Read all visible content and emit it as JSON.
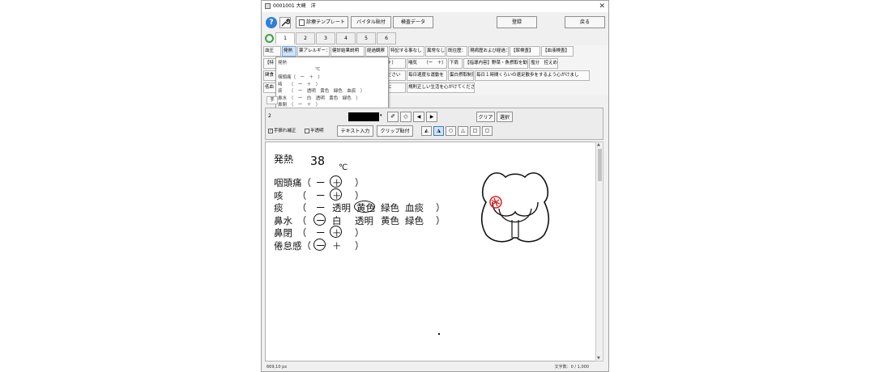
{
  "window": {
    "title": "0001001 大崎　洋",
    "close_glyph": "✕"
  },
  "toolbar": {
    "help": "?",
    "wrench": "🔧",
    "template_button": "診療テンプレート",
    "vital_button": "バイタル貼付",
    "exam_button": "検査データ",
    "register_button": "登録",
    "back_button": "戻る"
  },
  "number_tabs": [
    "1",
    "2",
    "3",
    "4",
    "5",
    "6"
  ],
  "active_number_tab": "1",
  "phrase_rows": [
    [
      "血圧",
      "発熱",
      "薬アレルギー：",
      "健診結果説明",
      "経過観察",
      "特記する事なし",
      "異常なし",
      "既往歴：",
      "現病歴および経過：",
      "【尿検査】",
      "【血液検査】"
    ],
    [
      "【特",
      "",
      "",
      "",
      "ー　＋）",
      "喘気　　（ー　＋）",
      "下肩",
      "【指導内容】野菜・魚摂取を勧める",
      "塩分　控えめに"
    ],
    [
      "関食",
      "",
      "",
      "",
      "てください",
      "毎日適度な運動を",
      "蛋白摂取制限",
      "毎日１時間くらいの速足散歩をするよう心がけまし"
    ],
    [
      "低血",
      "",
      "",
      "",
      "ように",
      "規則正しい生活を心がけてください"
    ]
  ],
  "popup": {
    "title": "発熱",
    "unit": "℃",
    "lines": [
      "咽頭痛（　ー　＋　）",
      "咳　　（　ー　＋　）",
      "痰　　（　ー　透明　黄色　緑色　血痰　）",
      "鼻水　（　ー　白　透明　黄色　緑色　）",
      "鼻閉　（　ー　＋　）",
      "倦怠感（　ー　＋　）"
    ]
  },
  "subtab_label": "手",
  "draw_toolbar": {
    "number": "2",
    "color": "#000000",
    "clear_label": "クリア",
    "select_label": "選択",
    "eraser_icon": "◇",
    "prev_icon": "◀",
    "next_icon": "▶",
    "hand_correction_label": "手振れ補正",
    "hand_correction_checked": true,
    "translucent_label": "半透明",
    "translucent_checked": false,
    "text_input_button": "テキスト入力",
    "clip_paste_button": "クリップ貼付",
    "shape_icons": [
      "△",
      "⊿",
      "○",
      "△",
      "□",
      "□"
    ]
  },
  "canvas": {
    "title": "発熱",
    "temperature": "38",
    "unit": "℃",
    "rows": [
      {
        "label": "咽頭痛（",
        "opts": [
          "ー",
          "＋"
        ],
        "circled": "＋"
      },
      {
        "label": "咳　　（",
        "opts": [
          "ー",
          "＋"
        ],
        "circled": "＋"
      },
      {
        "label": "痰　　（",
        "opts": [
          "ー",
          "透明",
          "黄色",
          "緑色",
          "血痰"
        ],
        "circled": "黄色"
      },
      {
        "label": "鼻水　（",
        "opts": [
          "ー",
          "白",
          "透明",
          "黄色",
          "緑色"
        ],
        "circled": "ー"
      },
      {
        "label": "鼻閉　（",
        "opts": [
          "ー",
          "＋"
        ],
        "circled": "＋"
      },
      {
        "label": "倦怠感（",
        "opts": [
          "ー",
          "＋"
        ],
        "circled": "ー"
      }
    ],
    "close_paren": "）",
    "throat_mark_color": "#e02020"
  },
  "status": {
    "coords": "669,10 px",
    "char_count": "文字数：0 / 1,000"
  }
}
